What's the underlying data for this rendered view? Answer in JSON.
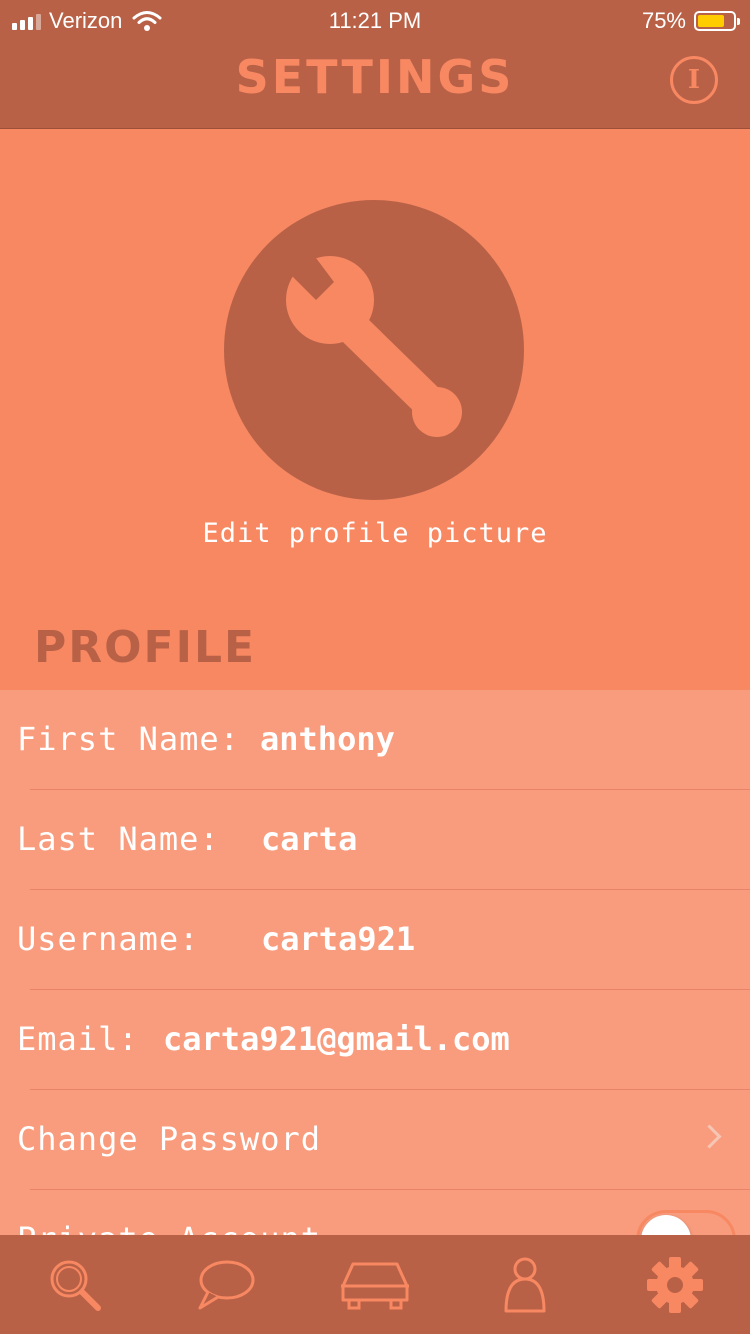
{
  "status_bar": {
    "carrier": "Verizon",
    "time": "11:21 PM",
    "battery_percent": "75%",
    "battery_level": 0.75
  },
  "header": {
    "title": "SETTINGS",
    "info_label": "I"
  },
  "avatar": {
    "icon": "wrench-icon",
    "edit_label": "Edit profile picture"
  },
  "profile": {
    "section_title": "PROFILE",
    "rows": [
      {
        "label": "First Name:",
        "value": "anthony"
      },
      {
        "label": "Last Name:",
        "value": "carta"
      },
      {
        "label": "Username:",
        "value": "carta921"
      },
      {
        "label": "Email:",
        "value": "carta921@gmail.com"
      },
      {
        "label": "Change Password"
      },
      {
        "label": "Private Account",
        "toggle_on": false
      }
    ]
  },
  "tab_bar": {
    "items": [
      {
        "icon": "search-icon",
        "active": false
      },
      {
        "icon": "chat-bubble-icon",
        "active": false
      },
      {
        "icon": "car-icon",
        "active": false
      },
      {
        "icon": "person-icon",
        "active": false
      },
      {
        "icon": "gear-icon",
        "active": true
      }
    ]
  },
  "colors": {
    "header_bg": "#b96147",
    "page_bg": "#f78862",
    "list_bg": "#f99c7e",
    "battery": "#ffcc00",
    "text": "#ffffff"
  }
}
